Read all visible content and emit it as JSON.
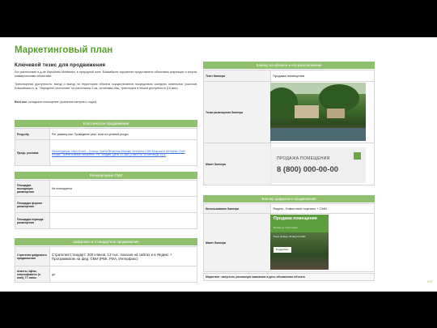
{
  "title": "Маркетинговый план",
  "left": {
    "heading": "Ключевой тезис для продвижения",
    "p1": "Лот расположен в д-не Хорошево-Мневники, в природной зоне. Ближайшее окружение представлено объектами рекреации и спорта, коммерческими объектами.",
    "p2": "Транспортная доступность: въезд и выезд на территорию объекта осуществляется посредством соседних земельных участков. Ближайшая ст. м. \"Народного ополчения\" на расстоянии 2 км, остановка общ. транспорта в пешей доступности (15 мин).",
    "p3_label": "Best use:",
    "p3_text": " складское помещение (хранение катеров и лодок)",
    "classic": {
      "header": "Классическое продвижение",
      "rows": [
        {
          "label": "Рекд-sity",
          "value": "Рег. размещ-ние: Проведение рекл. волн на целевой ресурс"
        },
        {
          "label": "Предс. реклама",
          "value": "Мессенджеры: https://t.me/... Статьи: Газета Вечерняя Москва, Интернет-СМИ Мoscow24 Интернет-СМИ Югоры. Газета Южные горизонты. PR: холдинг. Дата: 2 СМИ (1 сент. по 15 сентября 2022"
        }
      ]
    },
    "regional": {
      "header": "Региональные СМИ",
      "rows": [
        {
          "label": "Площадки выходящих размещения",
          "value": "Не планируется"
        },
        {
          "label": "Площадки формат размещения",
          "value": ""
        },
        {
          "label": "Площадки периода размещения",
          "value": ""
        }
      ]
    },
    "digital": {
      "header": "Цифровое и Стандартное продвижение",
      "rows": [
        {
          "label": "Стратегия цифрового продвижения",
          "value": "Стратегия Стандарт: 200 кликов, 13 тыс. показов на сайтах и в Яндекс + Программатик на фед. СМИ (РБК, РИА, Интерфакс)"
        },
        {
          "label": "Анкеты, Щёки, классификаты (e-mail), TГ-ланы",
          "value": "да"
        }
      ]
    }
  },
  "right": {
    "banner_header": "Баннер на объекте и его расположение",
    "rows": [
      {
        "label": "Текст баннера",
        "value": "Продажа помещения"
      },
      {
        "label": "Точка размещения баннера",
        "value": ""
      },
      {
        "label": "Макет баннера",
        "value": ""
      }
    ],
    "banner_title": "ПРОДАЖА ПОМЕЩЕНИЯ",
    "banner_phone": "8 (800) 000-00-00",
    "digital_header": "Баннер цифрового продвижения",
    "drows": [
      {
        "label": "Использование баннера",
        "value": "Яндекс, Новостные порталы + СМИ"
      },
      {
        "label": "Макет баннера",
        "value": ""
      }
    ],
    "dbanner_title": "Продажа помещения",
    "dbanner_sub": "Москва, ул. Строгинская",
    "dbanner_date": "Торги пройдут 00 августа 2022",
    "dbanner_cta": "Подробнее",
    "note": "Маркетинг: запустить рекламную кампанию в день объявления объекта"
  },
  "page_number": "ЛОТ"
}
